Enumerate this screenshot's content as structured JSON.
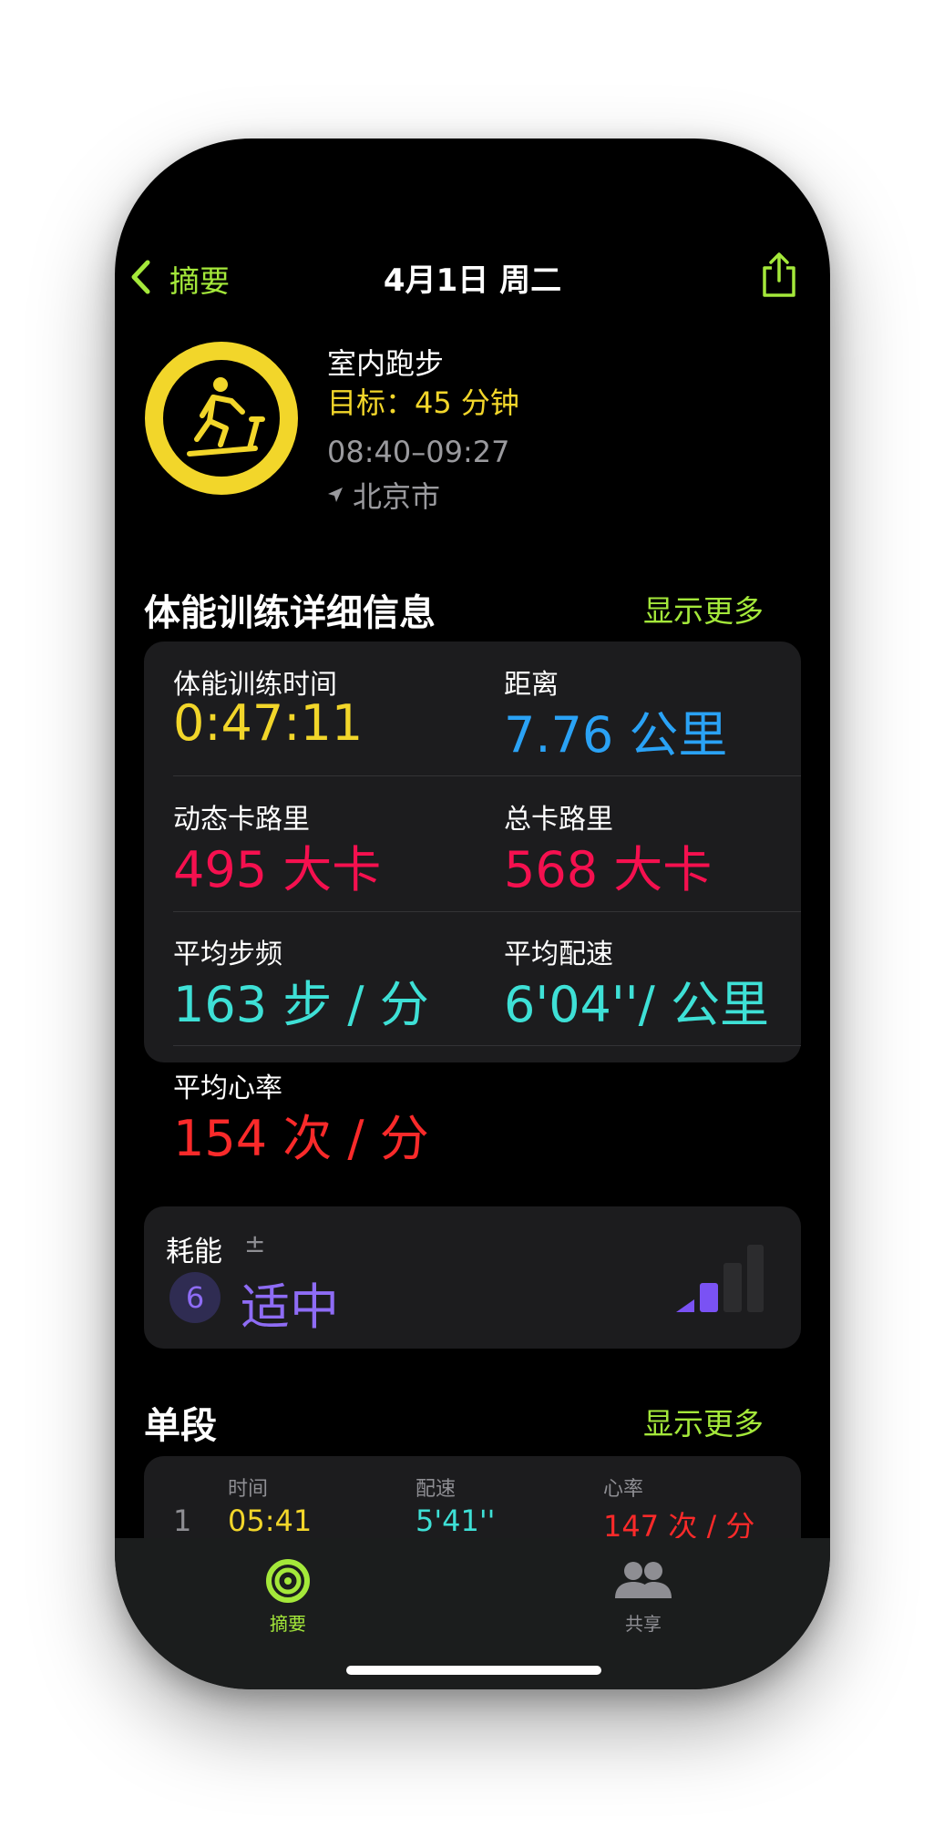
{
  "nav": {
    "back_label": "摘要",
    "title": "4月1日 周二",
    "share_icon": "share-icon"
  },
  "workout": {
    "name": "室内跑步",
    "goal": "目标：45 分钟",
    "time_range": "08:40–09:27",
    "location": "北京市",
    "goal_progress": 1.0,
    "accent": "#f2d62a"
  },
  "details": {
    "title": "体能训练详细信息",
    "show_more": "显示更多",
    "metrics": [
      {
        "label": "体能训练时间",
        "value": "0:47:11",
        "color": "#f2d62a"
      },
      {
        "label": "距离",
        "value": "7.76 公里",
        "color": "#2aa2f5"
      },
      {
        "label": "动态卡路里",
        "value": "495 大卡",
        "color": "#f5104f"
      },
      {
        "label": "总卡路里",
        "value": "568 大卡",
        "color": "#f5104f"
      },
      {
        "label": "平均步频",
        "value": "163 步 / 分",
        "color": "#3ee0d6"
      },
      {
        "label": "平均配速",
        "value": "6'04''/ 公里",
        "color": "#3ee0d6"
      },
      {
        "label": "平均心率",
        "value": "154 次 / 分",
        "color": "#fa2a2a"
      }
    ]
  },
  "effort": {
    "label": "耗能",
    "pm": "±",
    "level": "6",
    "word": "适中",
    "bars_filled": 2,
    "bars_total": 4,
    "color": "#7a52f4"
  },
  "splits": {
    "title": "单段",
    "show_more": "显示更多",
    "headers": [
      "时间",
      "配速",
      "心率"
    ],
    "rows": [
      {
        "index": "1",
        "time": "05:41",
        "pace": "5'41''",
        "hr": "147 次 / 分"
      }
    ]
  },
  "tabbar": {
    "tabs": [
      {
        "label": "摘要",
        "icon": "activity-rings-icon",
        "active": true
      },
      {
        "label": "共享",
        "icon": "people-icon",
        "active": false
      }
    ],
    "active_color": "#a4e83a",
    "inactive_color": "#8e8e93"
  }
}
